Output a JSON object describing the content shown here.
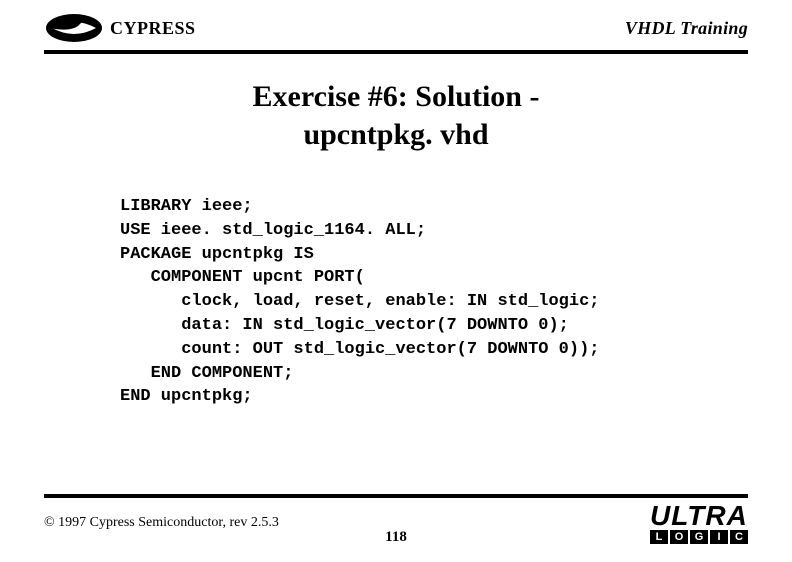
{
  "header": {
    "brand": "CYPRESS",
    "subject": "VHDL Training"
  },
  "title": {
    "line1": "Exercise #6: Solution -",
    "line2": "upcntpkg. vhd"
  },
  "code": {
    "l1": "LIBRARY ieee;",
    "l2": "USE ieee. std_logic_1164. ALL;",
    "l3": "PACKAGE upcntpkg IS",
    "l4": "   COMPONENT upcnt PORT(",
    "l5": "      clock, load, reset, enable: IN std_logic;",
    "l6": "      data: IN std_logic_vector(7 DOWNTO 0);",
    "l7": "      count: OUT std_logic_vector(7 DOWNTO 0));",
    "l8": "   END COMPONENT;",
    "l9": "END upcntpkg;"
  },
  "footer": {
    "copyright": "© 1997 Cypress Semiconductor, rev 2.5.3",
    "page": "118",
    "ultra": "ULTRA",
    "ultra_sub": {
      "a": "L",
      "b": "O",
      "c": "G",
      "d": "I",
      "e": "C"
    }
  }
}
